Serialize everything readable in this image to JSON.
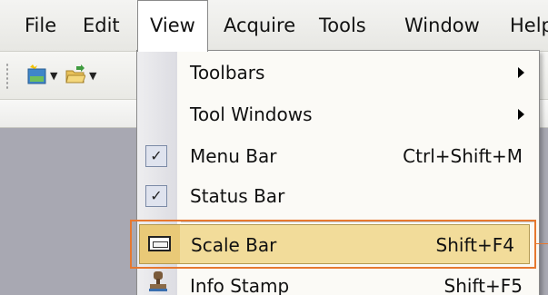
{
  "menubar": {
    "items": [
      {
        "label": "File"
      },
      {
        "label": "Edit"
      },
      {
        "label": "View"
      },
      {
        "label": "Acquire"
      },
      {
        "label": "Tools"
      },
      {
        "label": "Window"
      },
      {
        "label": "Help"
      }
    ]
  },
  "toolbar": {
    "icons": [
      "new-image-icon",
      "open-folder-icon"
    ]
  },
  "view_menu": {
    "items": [
      {
        "label": "Toolbars",
        "shortcut": "",
        "submenu": true
      },
      {
        "label": "Tool Windows",
        "shortcut": "",
        "submenu": true
      },
      {
        "label": "Menu Bar",
        "shortcut": "Ctrl+Shift+M",
        "checked": true
      },
      {
        "label": "Status Bar",
        "shortcut": "",
        "checked": true
      },
      {
        "label": "Scale Bar",
        "shortcut": "Shift+F4",
        "highlighted": true
      },
      {
        "label": "Info Stamp",
        "shortcut": "Shift+F5"
      }
    ],
    "check_glyph": "✓"
  },
  "colors": {
    "highlight": "#f2dc9a",
    "callout": "#e67830"
  }
}
